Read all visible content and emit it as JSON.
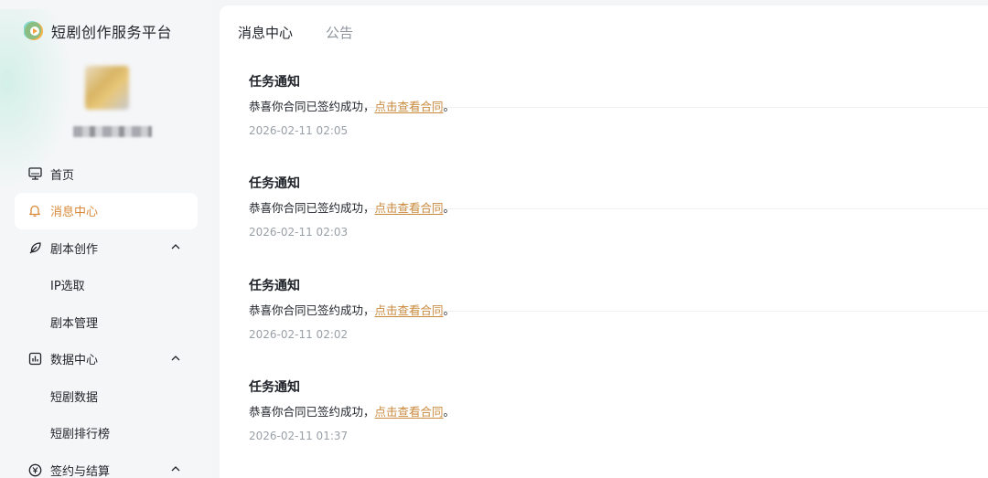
{
  "brand": {
    "title": "短剧创作服务平台"
  },
  "sidebar": {
    "items": [
      {
        "label": "首页",
        "icon": "monitor-icon",
        "active": false
      },
      {
        "label": "消息中心",
        "icon": "bell-icon",
        "active": true
      },
      {
        "label": "剧本创作",
        "icon": "feather-icon",
        "expandable": true
      },
      {
        "label": "IP选取",
        "sub": true
      },
      {
        "label": "剧本管理",
        "sub": true
      },
      {
        "label": "数据中心",
        "icon": "chart-icon",
        "expandable": true
      },
      {
        "label": "短剧数据",
        "sub": true
      },
      {
        "label": "短剧排行榜",
        "sub": true
      },
      {
        "label": "签约与结算",
        "icon": "yen-icon",
        "expandable": true
      }
    ]
  },
  "main": {
    "tabs": [
      {
        "label": "消息中心",
        "active": true
      },
      {
        "label": "公告",
        "active": false
      }
    ],
    "messages": [
      {
        "title": "任务通知",
        "text": "恭喜你合同已签约成功，",
        "link": "点击查看合同",
        "suffix": "。",
        "time": "2026-02-11 02:05"
      },
      {
        "title": "任务通知",
        "text": "恭喜你合同已签约成功，",
        "link": "点击查看合同",
        "suffix": "。",
        "time": "2026-02-11 02:03"
      },
      {
        "title": "任务通知",
        "text": "恭喜你合同已签约成功，",
        "link": "点击查看合同",
        "suffix": "。",
        "time": "2026-02-11 02:02"
      },
      {
        "title": "任务通知",
        "text": "恭喜你合同已签约成功，",
        "link": "点击查看合同",
        "suffix": "。",
        "time": "2026-02-11 01:37"
      }
    ]
  },
  "colors": {
    "accent": "#d9893a",
    "link": "#c98a3c",
    "muted": "#9aa0a8"
  }
}
